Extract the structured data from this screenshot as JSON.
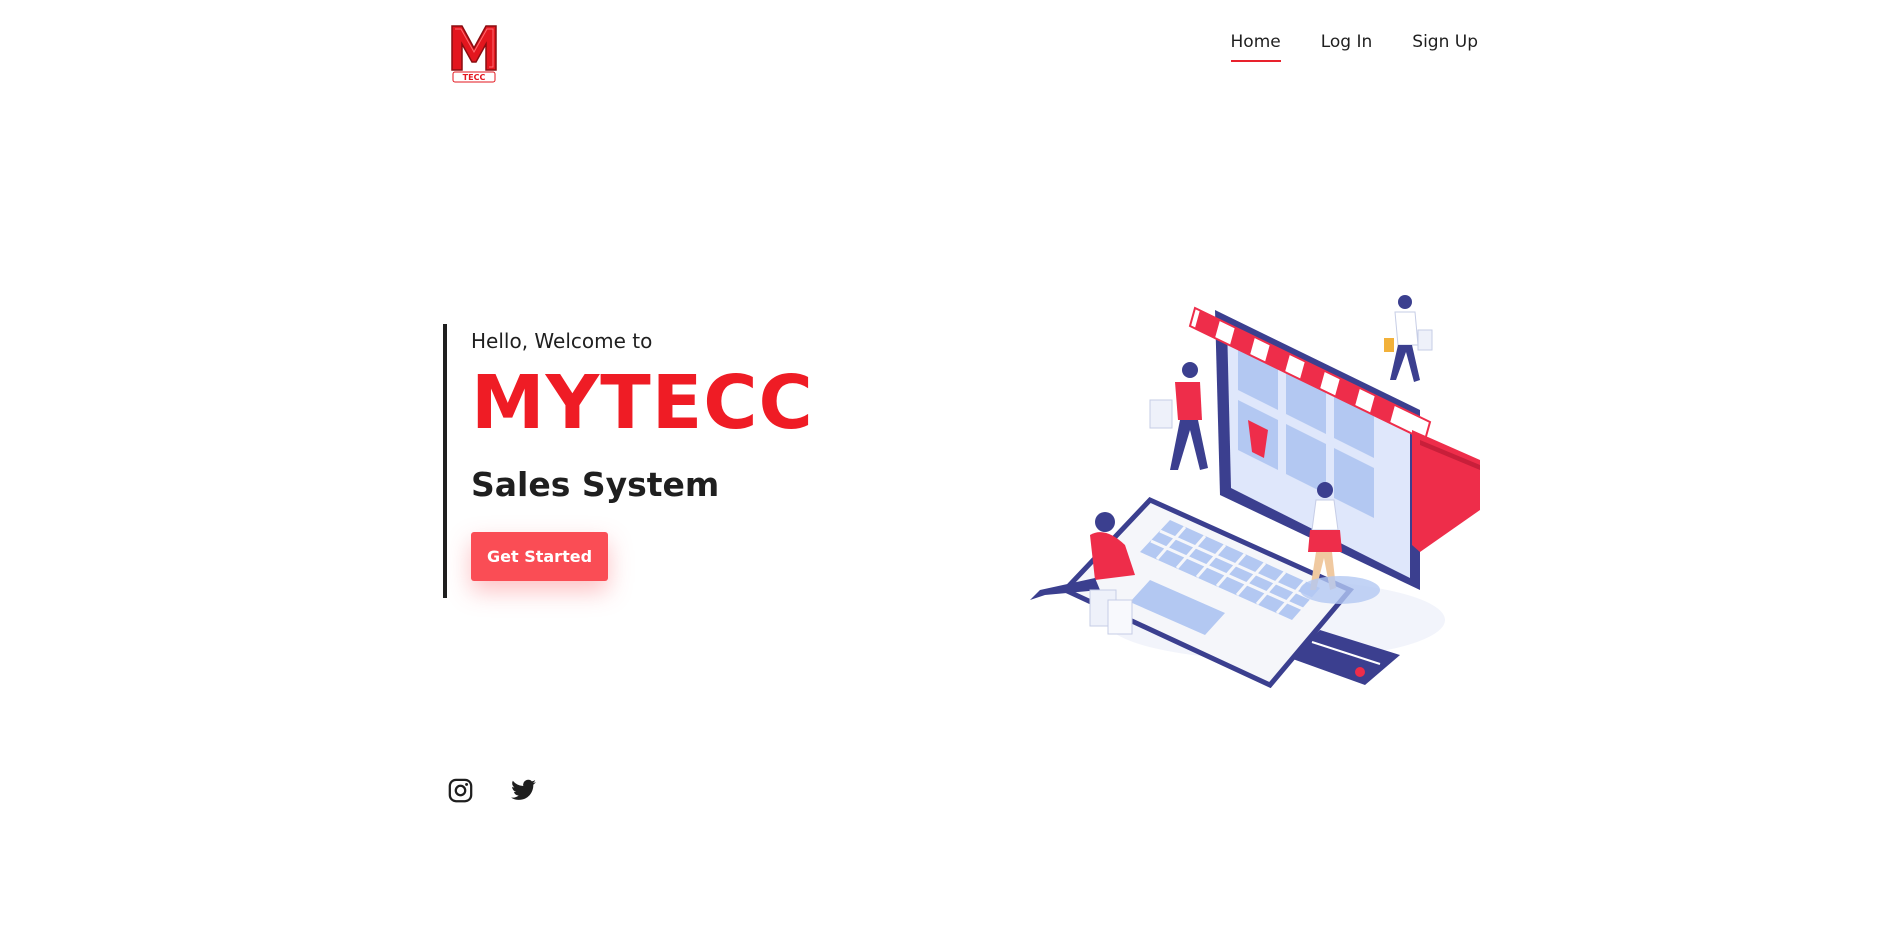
{
  "header": {
    "logo_text": "TECC",
    "nav": [
      {
        "label": "Home",
        "active": true
      },
      {
        "label": "Log In",
        "active": false
      },
      {
        "label": "Sign Up",
        "active": false
      }
    ]
  },
  "hero": {
    "greeting": "Hello, Welcome to",
    "brand": "MYTECC",
    "subtitle": "Sales System",
    "cta_label": "Get Started"
  },
  "social": [
    {
      "icon": "instagram-icon"
    },
    {
      "icon": "twitter-icon"
    }
  ],
  "colors": {
    "brand_red": "#ef1c25",
    "button_red": "#fa4d55",
    "nav_underline": "#e8222d",
    "text_dark": "#1f1f1f",
    "illustration_navy": "#3b3f8f",
    "illustration_light_blue": "#b3c8f2"
  }
}
